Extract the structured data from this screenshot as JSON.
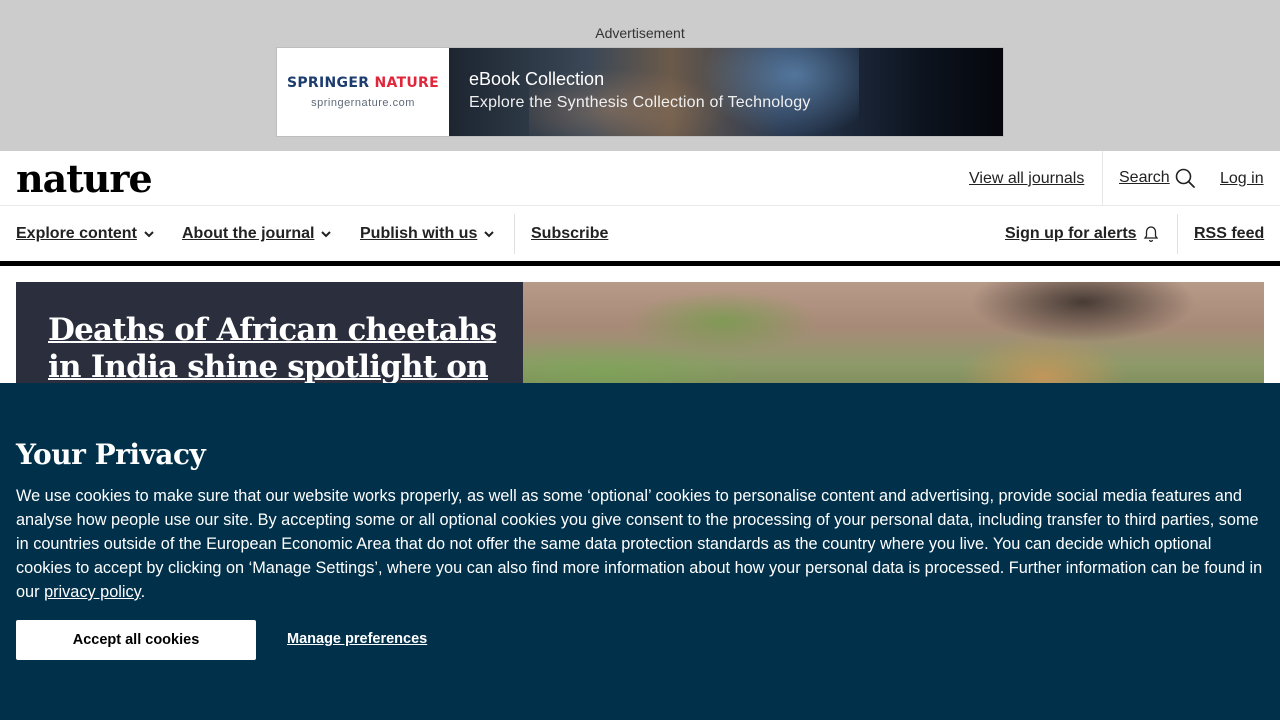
{
  "ad": {
    "label": "Advertisement",
    "brand_part1": "SPRINGER",
    "brand_part2": "NATURE",
    "brand_url": "springernature.com",
    "title": "eBook Collection",
    "subtitle": "Explore the Synthesis Collection of Technology"
  },
  "header": {
    "logo": "nature",
    "view_all_journals": "View all journals",
    "search": "Search",
    "login": "Log in"
  },
  "nav": {
    "explore": "Explore content",
    "about": "About the journal",
    "publish": "Publish with us",
    "subscribe": "Subscribe",
    "alerts": "Sign up for alerts",
    "rss": "RSS feed"
  },
  "hero": {
    "title": "Deaths of African cheetahs in India shine spotlight on"
  },
  "privacy": {
    "title": "Your Privacy",
    "body_prefix": "We use cookies to make sure that our website works properly, as well as some ‘optional’ cookies to personalise content and advertising, provide social media features and analyse how people use our site. By accepting some or all optional cookies you give consent to the processing of your personal data, including transfer to third parties, some in countries outside of the European Economic Area that do not offer the same data protection standards as the country where you live. You can decide which optional cookies to accept by clicking on ‘Manage Settings’, where you can also find more information about how your personal data is processed. Further information can be found in our ",
    "policy_link": "privacy policy",
    "body_suffix": ".",
    "accept_button": "Accept all cookies",
    "manage_button": "Manage preferences"
  },
  "colors": {
    "privacy_bg": "#00304a",
    "hero_bg": "#2a2e3d",
    "ad_band": "#cccccc"
  }
}
